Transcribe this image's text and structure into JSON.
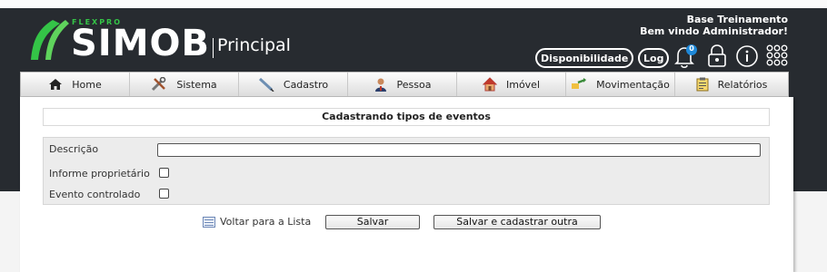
{
  "brand": {
    "tagline": "FLEXPRO",
    "name": "SIMOB",
    "module": "Principal"
  },
  "user": {
    "company": "Base Treinamento",
    "greeting": "Bem vindo Administrador!"
  },
  "header_actions": {
    "availability": "Disponibilidade",
    "log": "Log",
    "notification_count": "0"
  },
  "nav": [
    {
      "label": "Home",
      "icon": "home-icon"
    },
    {
      "label": "Sistema",
      "icon": "tools-icon"
    },
    {
      "label": "Cadastro",
      "icon": "pen-icon"
    },
    {
      "label": "Pessoa",
      "icon": "person-icon"
    },
    {
      "label": "Imóvel",
      "icon": "house-icon"
    },
    {
      "label": "Movimentação",
      "icon": "transfer-icon"
    },
    {
      "label": "Relatórios",
      "icon": "clipboard-icon"
    }
  ],
  "form": {
    "title": "Cadastrando tipos de eventos",
    "description_label": "Descrição",
    "description_value": "",
    "owner_label": "Informe proprietário",
    "owner_checked": false,
    "controlled_label": "Evento controlado",
    "controlled_checked": false
  },
  "actions": {
    "back": "Voltar para a Lista",
    "save": "Salvar",
    "save_new": "Salvar e cadastrar outra"
  }
}
